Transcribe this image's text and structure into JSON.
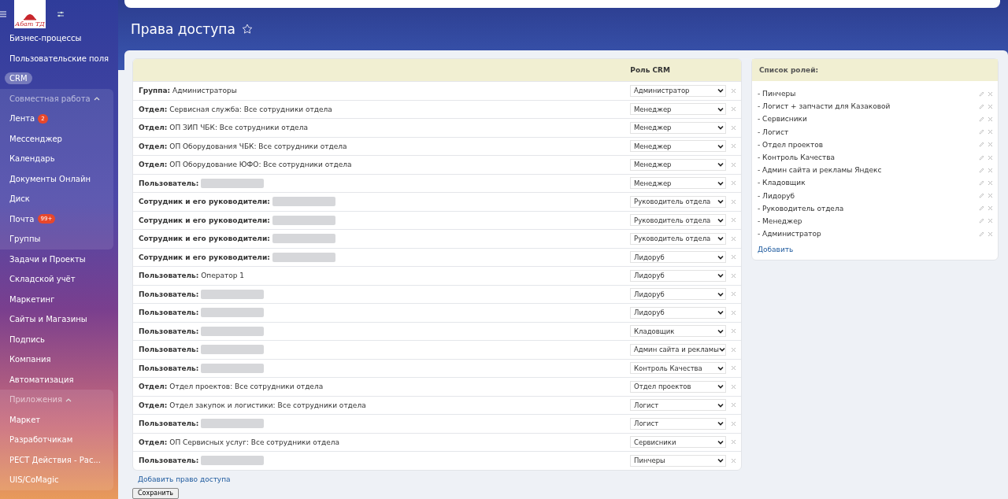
{
  "sidebar": {
    "logo_text": "Абат ТД",
    "items": [
      {
        "label": "Бизнес-процессы",
        "selected": false
      },
      {
        "label": "Пользовательские поля",
        "selected": false
      },
      {
        "label": "CRM",
        "selected": true
      }
    ],
    "groups": [
      {
        "title": "Совместная работа",
        "expanded": true,
        "items": [
          {
            "label": "Лента",
            "badge": "2"
          },
          {
            "label": "Мессенджер"
          },
          {
            "label": "Календарь"
          },
          {
            "label": "Документы Онлайн"
          },
          {
            "label": "Диск"
          },
          {
            "label": "Почта",
            "badge": "99+"
          },
          {
            "label": "Группы"
          }
        ]
      },
      {
        "items": [
          {
            "label": "Задачи и Проекты"
          },
          {
            "label": "Складской учёт"
          },
          {
            "label": "Маркетинг"
          },
          {
            "label": "Сайты и Магазины"
          },
          {
            "label": "Подпись"
          },
          {
            "label": "Компания"
          },
          {
            "label": "Автоматизация"
          }
        ]
      },
      {
        "title": "Приложения",
        "expanded": true,
        "items": [
          {
            "label": "Маркет"
          },
          {
            "label": "Разработчикам"
          },
          {
            "label": "РЕСТ Действия - Рас..."
          },
          {
            "label": "UIS/CoMagic"
          }
        ]
      }
    ]
  },
  "page": {
    "title": "Права доступа"
  },
  "access_table": {
    "columns": [
      "Роль CRM"
    ],
    "rows": [
      {
        "label": "Группа:",
        "value": "Администраторы",
        "blurred": false,
        "role": "Администратор"
      },
      {
        "label": "Отдел:",
        "value": "Сервисная служба: Все сотрудники отдела",
        "blurred": false,
        "role": "Менеджер"
      },
      {
        "label": "Отдел:",
        "value": "ОП ЗИП ЧБК: Все сотрудники отдела",
        "blurred": false,
        "role": "Менеджер"
      },
      {
        "label": "Отдел:",
        "value": "ОП Оборудования ЧБК: Все сотрудники отдела",
        "blurred": false,
        "role": "Менеджер"
      },
      {
        "label": "Отдел:",
        "value": "ОП Оборудование ЮФО: Все сотрудники отдела",
        "blurred": false,
        "role": "Менеджер"
      },
      {
        "label": "Пользователь:",
        "value": null,
        "blurred": true,
        "role": "Менеджер"
      },
      {
        "label": "Сотрудник и его руководители:",
        "value": null,
        "blurred": true,
        "role": "Руководитель отдела"
      },
      {
        "label": "Сотрудник и его руководители:",
        "value": null,
        "blurred": true,
        "role": "Руководитель отдела"
      },
      {
        "label": "Сотрудник и его руководители:",
        "value": null,
        "blurred": true,
        "role": "Руководитель отдела"
      },
      {
        "label": "Сотрудник и его руководители:",
        "value": null,
        "blurred": true,
        "role": "Лидоруб"
      },
      {
        "label": "Пользователь:",
        "value": "Оператор 1",
        "blurred": false,
        "role": "Лидоруб"
      },
      {
        "label": "Пользователь:",
        "value": null,
        "blurred": true,
        "role": "Лидоруб"
      },
      {
        "label": "Пользователь:",
        "value": null,
        "blurred": true,
        "role": "Лидоруб"
      },
      {
        "label": "Пользователь:",
        "value": null,
        "blurred": true,
        "role": "Кладовщик"
      },
      {
        "label": "Пользователь:",
        "value": null,
        "blurred": true,
        "role": "Админ сайта и рекламы"
      },
      {
        "label": "Пользователь:",
        "value": null,
        "blurred": true,
        "role": "Контроль Качества"
      },
      {
        "label": "Отдел:",
        "value": "Отдел проектов: Все сотрудники отдела",
        "blurred": false,
        "role": "Отдел проектов"
      },
      {
        "label": "Отдел:",
        "value": "Отдел закупок и логистики: Все сотрудники отдела",
        "blurred": false,
        "role": "Логист"
      },
      {
        "label": "Пользователь:",
        "value": null,
        "blurred": true,
        "role": "Логист"
      },
      {
        "label": "Отдел:",
        "value": "ОП Сервисных услуг: Все сотрудники отдела",
        "blurred": false,
        "role": "Сервисники"
      },
      {
        "label": "Пользователь:",
        "value": null,
        "blurred": true,
        "role": "Пинчеры"
      }
    ],
    "add_link": "Добавить право доступа"
  },
  "save_button": "Сохранить",
  "roles_panel": {
    "title": "Список ролей:",
    "roles": [
      "- Пинчеры",
      "- Логист + запчасти для Казаковой",
      "- Сервисники",
      "- Логист",
      "- Отдел проектов",
      "- Контроль Качества",
      "- Админ сайта и рекламы Яндекс",
      "- Кладовщик",
      "- Лидоруб",
      "- Руководитель отдела",
      "- Менеджер",
      "- Администратор"
    ],
    "add_link": "Добавить"
  }
}
